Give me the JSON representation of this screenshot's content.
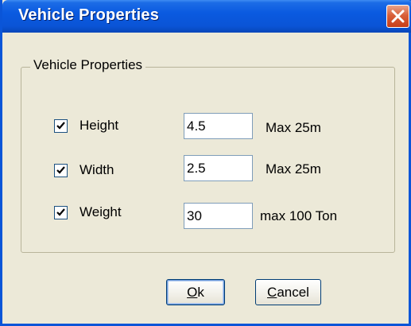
{
  "window": {
    "title": "Vehicle Properties"
  },
  "group": {
    "label": "Vehicle Properties"
  },
  "rows": [
    {
      "label": "Height",
      "checked": true,
      "value": "4.5",
      "limit": "Max 25m"
    },
    {
      "label": "Width",
      "checked": true,
      "value": "2.5",
      "limit": "Max 25m"
    },
    {
      "label": "Weight",
      "checked": true,
      "value": "30",
      "limit": "max 100 Ton"
    }
  ],
  "buttons": {
    "ok": {
      "mnemonic": "O",
      "rest": "k"
    },
    "cancel": {
      "mnemonic": "C",
      "rest": "ancel"
    }
  },
  "colors": {
    "titlebar": "#0A54D6",
    "dialog_bg": "#ECE9D8",
    "close_button": "#C63D17"
  }
}
